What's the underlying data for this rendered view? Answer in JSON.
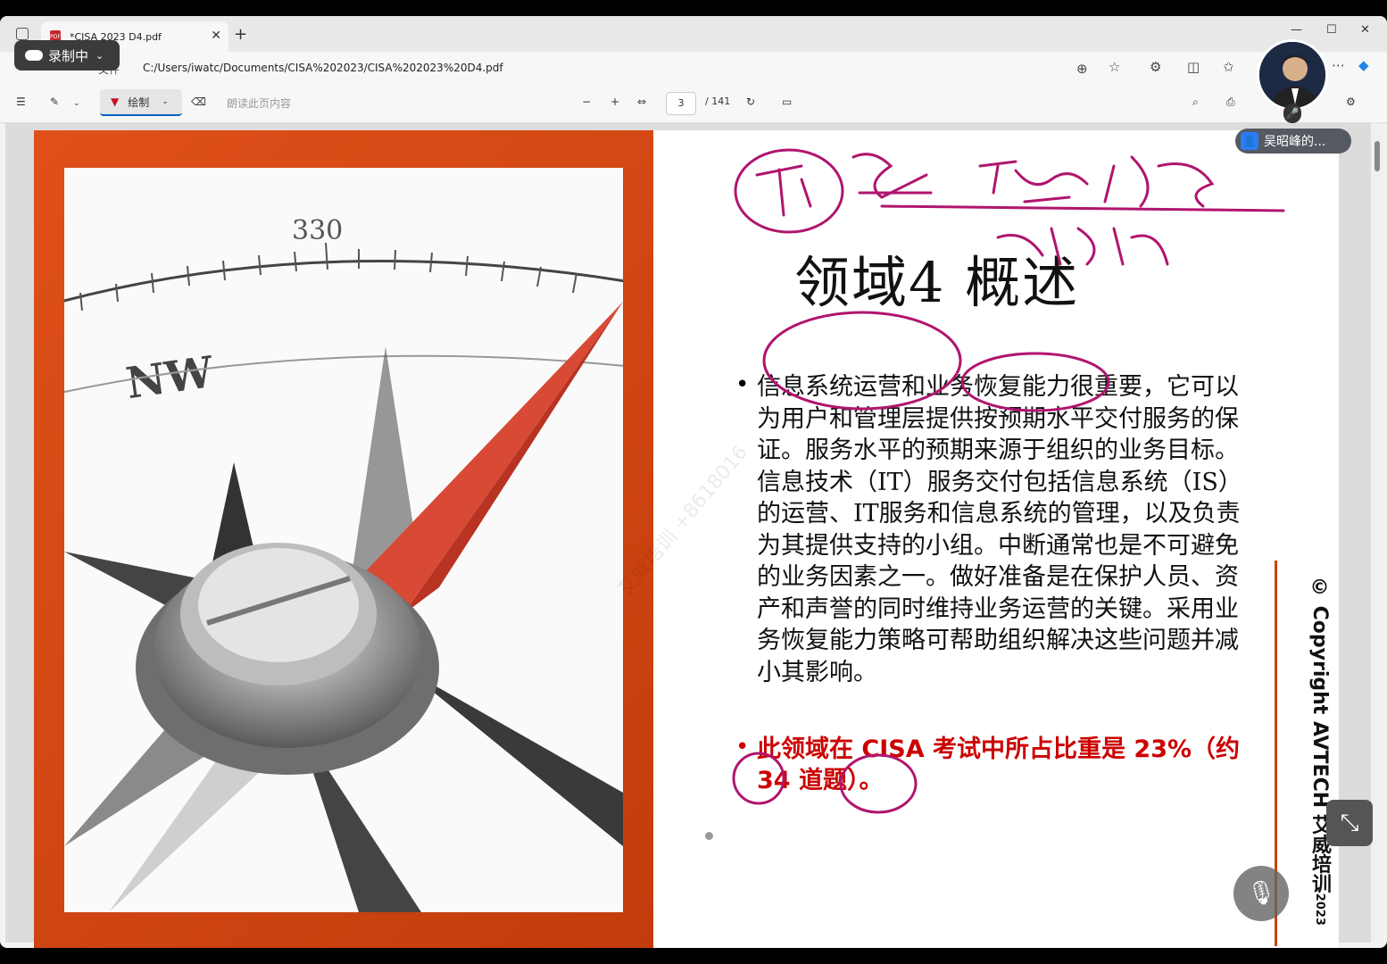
{
  "tab": {
    "title": "*CISA 2023 D4.pdf"
  },
  "recording": {
    "label": "录制中"
  },
  "address": {
    "label": "文件",
    "url": "C:/Users/iwatc/Documents/CISA%202023/CISA%202023%20D4.pdf"
  },
  "pdf_toolbar": {
    "draw_label": "绘制",
    "read_aloud_label": "朗读此页内容",
    "page_current": "3",
    "page_total": "/ 141"
  },
  "slide": {
    "title": "领域4 概述",
    "paragraph": "信息系统运营和业务恢复能力很重要，它可以为用户和管理层提供按预期水平交付服务的保证。服务水平的预期来源于组织的业务目标。信息技术（IT）服务交付包括信息系统（IS）的运营、IT服务和信息系统的管理，以及负责为其提供支持的小组。中断通常也是不可避免的业务因素之一。做好准备是在保护人员、资产和声誉的同时维持业务运营的关键。采用业务恢复能力策略可帮助组织解决这些问题并减小其影响。",
    "note": "此领域在 CISA 考试中所占比重是 23%（约 34 道题）。",
    "copyright": "© Copyright AVTECH 艾威培训",
    "copyright_year": "2023",
    "watermark": "艾威培训 +8618016",
    "compass_330": "330",
    "compass_nw": "NW"
  },
  "presenter": {
    "name": "吴昭峰的..."
  },
  "colors": {
    "accent": "#0a5fc4",
    "slide_orange": "#d9491a",
    "ink": "#b0156e",
    "note_red": "#cc0000"
  }
}
